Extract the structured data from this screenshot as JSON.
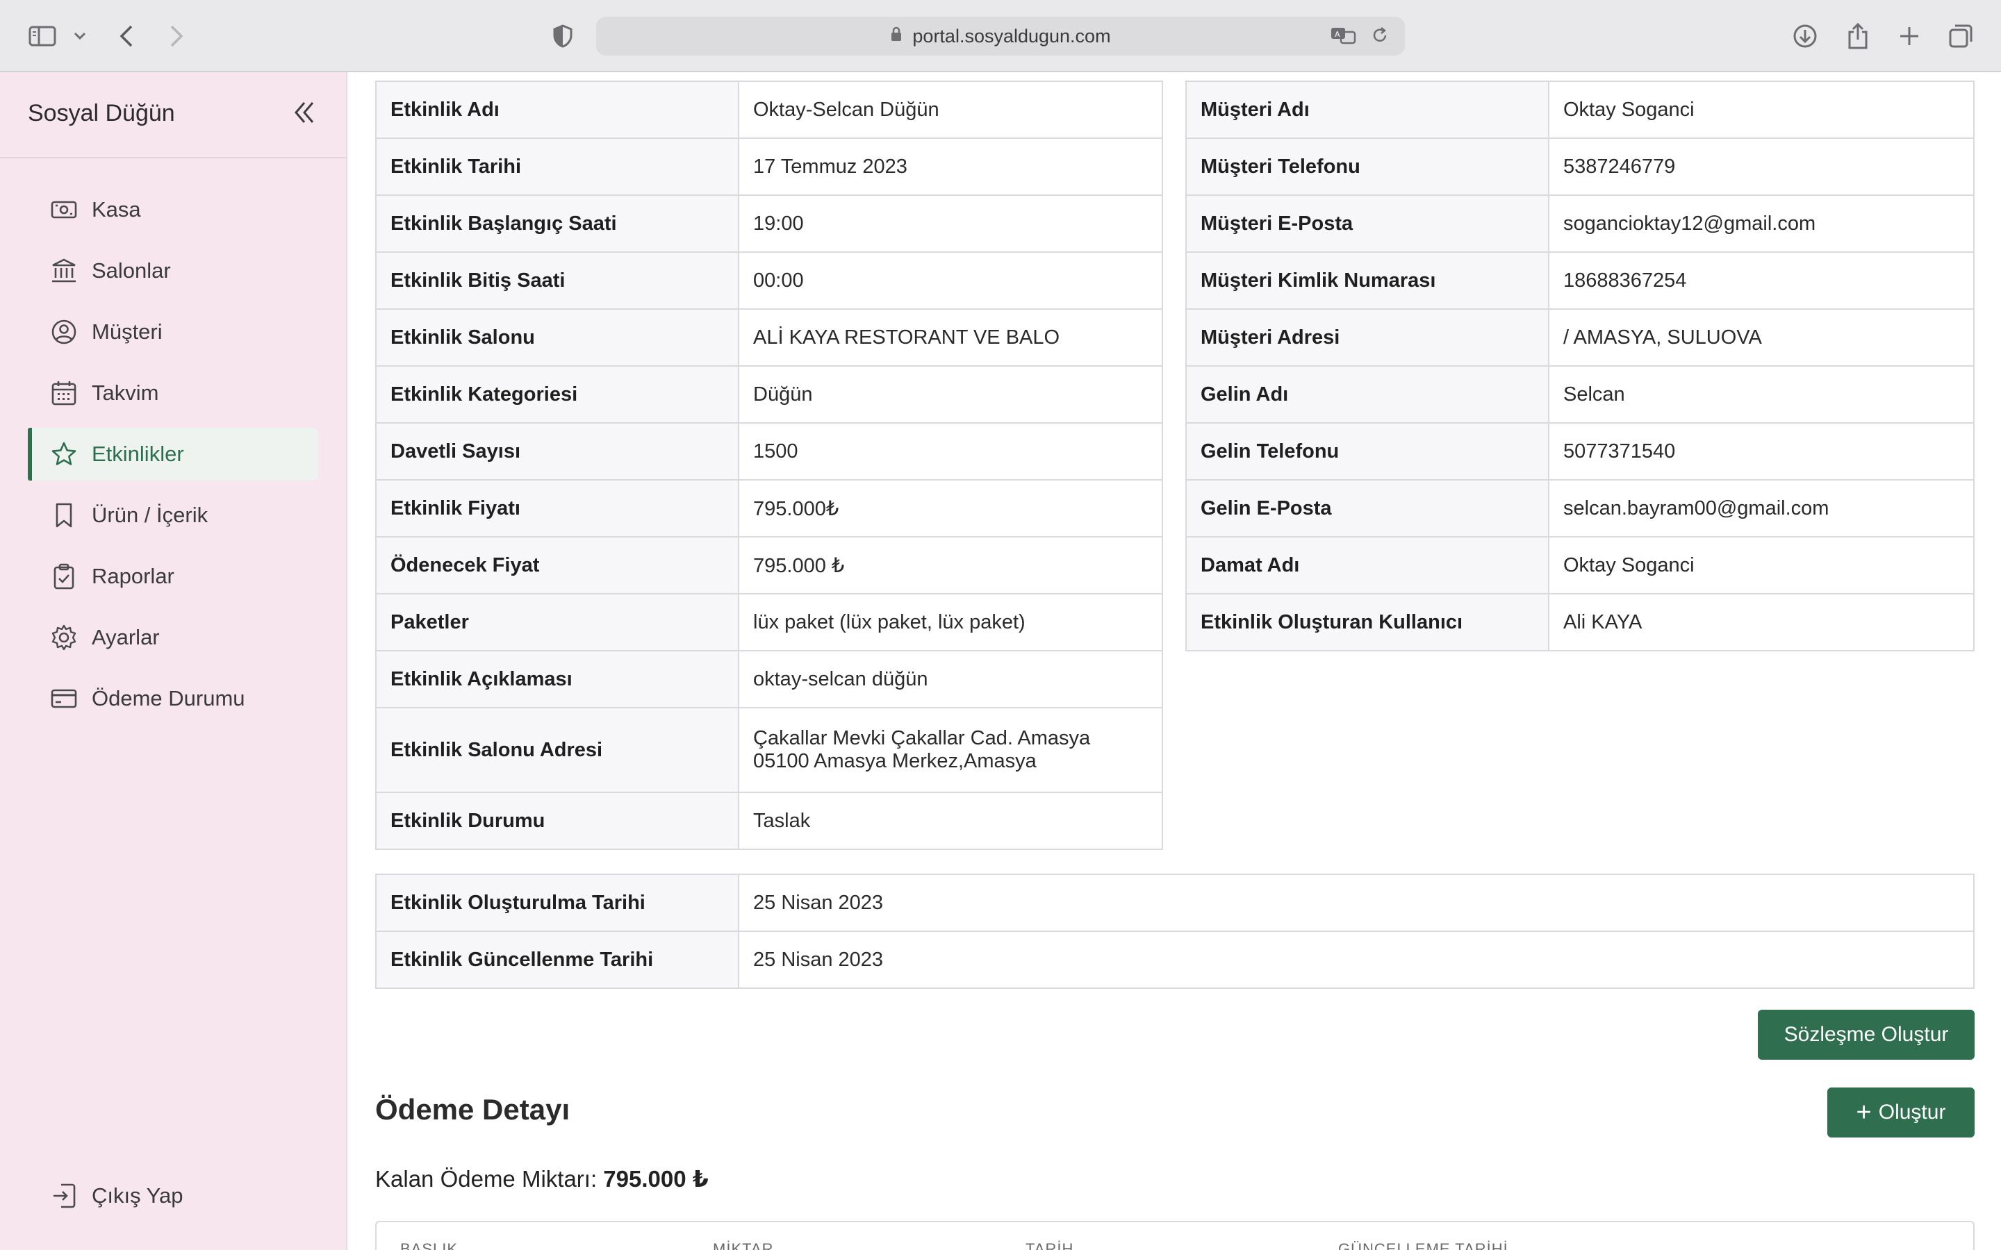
{
  "browser": {
    "url": "portal.sosyaldugun.com"
  },
  "sidebar": {
    "brand": "Sosyal Düğün",
    "items": [
      {
        "label": "Kasa",
        "icon": "cash-icon"
      },
      {
        "label": "Salonlar",
        "icon": "bank-icon"
      },
      {
        "label": "Müşteri",
        "icon": "user-circle-icon"
      },
      {
        "label": "Takvim",
        "icon": "calendar-icon"
      },
      {
        "label": "Etkinlikler",
        "icon": "star-icon",
        "active": true
      },
      {
        "label": "Ürün / İçerik",
        "icon": "bookmark-icon"
      },
      {
        "label": "Raporlar",
        "icon": "clipboard-check-icon"
      },
      {
        "label": "Ayarlar",
        "icon": "gear-icon"
      },
      {
        "label": "Ödeme Durumu",
        "icon": "credit-card-icon"
      }
    ],
    "logout": "Çıkış Yap"
  },
  "event": {
    "rows": [
      {
        "key": "Etkinlik Adı",
        "value": "Oktay-Selcan Düğün"
      },
      {
        "key": "Etkinlik Tarihi",
        "value": "17 Temmuz 2023"
      },
      {
        "key": "Etkinlik Başlangıç Saati",
        "value": "19:00"
      },
      {
        "key": "Etkinlik Bitiş Saati",
        "value": "00:00"
      },
      {
        "key": "Etkinlik Salonu",
        "value": "ALİ KAYA RESTORANT VE BALO"
      },
      {
        "key": "Etkinlik Kategoriesi",
        "value": "Düğün"
      },
      {
        "key": "Davetli Sayısı",
        "value": "1500"
      },
      {
        "key": "Etkinlik Fiyatı",
        "value": "795.000₺"
      },
      {
        "key": "Ödenecek Fiyat",
        "value": "795.000 ₺"
      },
      {
        "key": "Paketler",
        "value": "lüx paket (lüx paket, lüx paket)"
      },
      {
        "key": "Etkinlik Açıklaması",
        "value": "oktay-selcan düğün"
      },
      {
        "key": "Etkinlik Salonu Adresi",
        "value": "Çakallar Mevki Çakallar Cad. Amasya 05100 Amasya Merkez,Amasya"
      },
      {
        "key": "Etkinlik Durumu",
        "value": "Taslak"
      }
    ]
  },
  "customer": {
    "rows": [
      {
        "key": "Müşteri Adı",
        "value": "Oktay Soganci"
      },
      {
        "key": "Müşteri Telefonu",
        "value": "5387246779"
      },
      {
        "key": "Müşteri E-Posta",
        "value": "sogancioktay12@gmail.com"
      },
      {
        "key": "Müşteri Kimlik Numarası",
        "value": "18688367254"
      },
      {
        "key": "Müşteri Adresi",
        "value": "/ AMASYA, SULUOVA"
      },
      {
        "key": "Gelin Adı",
        "value": "Selcan"
      },
      {
        "key": "Gelin Telefonu",
        "value": "5077371540"
      },
      {
        "key": "Gelin E-Posta",
        "value": "selcan.bayram00@gmail.com"
      },
      {
        "key": "Damat Adı",
        "value": "Oktay Soganci"
      },
      {
        "key": "Etkinlik Oluşturan Kullanıcı",
        "value": "Ali KAYA"
      }
    ]
  },
  "dates": {
    "rows": [
      {
        "key": "Etkinlik Oluşturulma Tarihi",
        "value": "25 Nisan 2023"
      },
      {
        "key": "Etkinlik Güncellenme Tarihi",
        "value": "25 Nisan 2023"
      }
    ]
  },
  "actions": {
    "contract_button": "Sözleşme Oluştur",
    "create_button": "Oluştur"
  },
  "payment": {
    "title": "Ödeme Detayı",
    "remaining_label": "Kalan Ödeme Miktarı:",
    "remaining_value": "795.000 ₺",
    "columns": [
      "BAŞLIK",
      "MİKTAR",
      "TARİH",
      "GÜNCELLEME TARİHİ"
    ]
  },
  "colors": {
    "accent": "#2f6e4f",
    "sidebar_bg": "#f7e6ee"
  }
}
